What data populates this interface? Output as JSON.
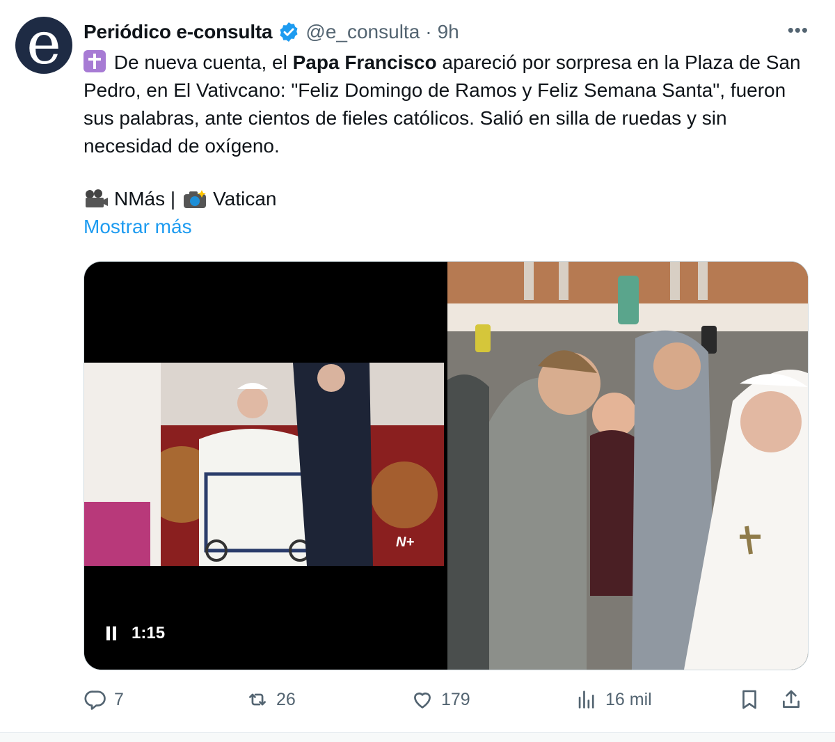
{
  "author": {
    "name": "Periódico e-consulta",
    "handle": "@e_consulta",
    "time": "9h",
    "avatar_letter": "e",
    "verified": true
  },
  "tweet": {
    "text_part1": " De nueva cuenta, el ",
    "text_bold": "Papa Francisco",
    "text_part2": " apareció por sorpresa en la Plaza de San Pedro, en El Vativcano: \"Feliz Domingo de Ramos y Feliz Semana Santa\", fueron sus palabras, ante cientos de fieles católicos. Salió en silla de ruedas y sin necesidad de oxígeno.",
    "credits_video": "NMás |",
    "credits_photo": "Vatican",
    "show_more": "Mostrar más"
  },
  "media": {
    "video_time": "1:15",
    "watermark": "N+"
  },
  "actions": {
    "replies": "7",
    "retweets": "26",
    "likes": "179",
    "views": "16 mil"
  },
  "icons": {
    "more": "more-icon",
    "verified": "verified-badge-icon",
    "reply": "reply-icon",
    "retweet": "retweet-icon",
    "like": "heart-icon",
    "views": "analytics-icon",
    "bookmark": "bookmark-icon",
    "share": "share-icon"
  },
  "colors": {
    "accent": "#1d9bf0",
    "secondary_text": "#536471",
    "avatar_bg": "#1e2b44"
  }
}
